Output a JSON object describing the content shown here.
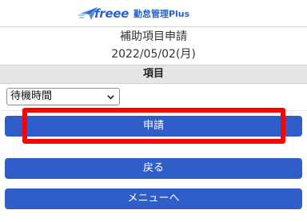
{
  "header": {
    "logo_brand": "freee",
    "logo_product": "勤怠管理Plus",
    "brand_color": "#2a63c9"
  },
  "page": {
    "title": "補助項目申請",
    "date": "2022/05/02(月)"
  },
  "section": {
    "heading": "項目"
  },
  "item_select": {
    "selected": "待機時間"
  },
  "buttons": {
    "apply": "申請",
    "back": "戻る",
    "menu": "メニューへ"
  },
  "colors": {
    "button_bg": "#2f5ecb",
    "highlight": "#ff0000",
    "section_bg": "#e6e6e6"
  }
}
